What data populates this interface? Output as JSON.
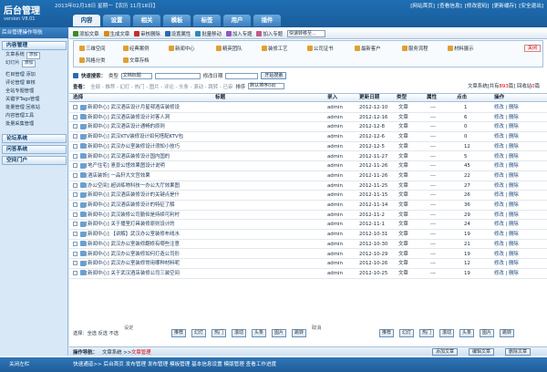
{
  "header": {
    "logo_title": "后台管理",
    "logo_version": "version V8.01",
    "date_line": "2013年02月18日 星期一【农历 11月18日】",
    "date_link": "农历 11月18日",
    "links": [
      "[网站首页]",
      "[查看信息]",
      "[修改密码]",
      "[更新缓存]",
      "[安全退出]"
    ],
    "tabs": [
      "内容",
      "设置",
      "相关",
      "模板",
      "标签",
      "用户",
      "插件"
    ]
  },
  "sidebar": {
    "title": "后台管理操作导航",
    "sections": [
      {
        "head": "内容管理",
        "items": [
          {
            "label": "文章系统",
            "btn": "添加"
          },
          {
            "label": "幻灯片",
            "btn": "添加"
          }
        ]
      },
      {
        "head": "",
        "items": [
          {
            "label": "栏目管理 添加"
          },
          {
            "label": "评论管理 审核"
          },
          {
            "label": "全站专题管理"
          },
          {
            "label": "关键字Tags管理"
          },
          {
            "label": "批量管理 回收站"
          },
          {
            "label": "内容管理工具"
          },
          {
            "label": "批量采集管理"
          }
        ]
      }
    ],
    "groups": [
      "论坛系统",
      "问答系统",
      "空间门户"
    ]
  },
  "toolbar": {
    "items": [
      {
        "label": "添加文章",
        "color": "#3d8a2a"
      },
      {
        "label": "生成文章",
        "color": "#d88a1a"
      },
      {
        "label": "审核删除",
        "color": "#c03030"
      },
      {
        "label": "设置属性",
        "color": "#2a6ab0"
      },
      {
        "label": "批量移动",
        "color": "#2a8ab0"
      },
      {
        "label": "加入专题",
        "color": "#8a5ac0"
      },
      {
        "label": "加入专题",
        "color": "#c05a8a"
      }
    ],
    "search_select": "快速转移至..."
  },
  "categories": [
    "三维空间",
    "经典案例",
    "新闻中心",
    "精英团队",
    "装修工艺",
    "公司证书",
    "最新客户",
    "服务流程",
    "材料展示",
    "风格分类",
    "文章存档"
  ],
  "close_label": "关闭",
  "quick_search": {
    "label": "快速搜索：",
    "type_label": "类型",
    "type_value": "文档标题",
    "date_label": "修改日期",
    "button": "开始搜索"
  },
  "filter": {
    "prefix": "查看：",
    "options": "全部 - 推荐 - 幻灯 - 热门 - 图片 - 评论 - 头条 - 滚动 - 跳转 - 已审",
    "sort_label": "排序",
    "sort_value": "默认排序(id)",
    "stats_prefix": "文章系统[共有",
    "stats_total": "893",
    "stats_mid": "篇]  回收站",
    "stats_recycle": "0",
    "stats_suffix": "篇"
  },
  "table": {
    "headers": [
      "选择",
      "标题",
      "录入",
      "更新日期",
      "类型",
      "属性",
      "点击",
      "操作"
    ],
    "rows": [
      {
        "title": "[新闻中心] 武汉酒店设计月星鄂酒店装修设",
        "author": "admin",
        "date": "2012-12-10",
        "type": "文章",
        "attr": "---",
        "hits": "1",
        "ops": "修改 | 删除"
      },
      {
        "title": "[新闻中心] 武汉酒店装修设计对客人洞",
        "author": "admin",
        "date": "2012-12-16",
        "type": "文章",
        "attr": "---",
        "hits": "6",
        "ops": "修改 | 删除"
      },
      {
        "title": "[新闻中心] 武汉酒店设计通畅的原则",
        "author": "admin",
        "date": "2012-12-8",
        "type": "文章",
        "attr": "---",
        "hits": "0",
        "ops": "修改 | 删除"
      },
      {
        "title": "[新闻中心] 武汉KTV装修设计如何搭配KTV包",
        "author": "admin",
        "date": "2012-12-6",
        "type": "文章",
        "attr": "---",
        "hits": "0",
        "ops": "修改 | 删除"
      },
      {
        "title": "[新闻中心] 武汉办公室装修设计须知小技巧",
        "author": "admin",
        "date": "2012-12-5",
        "type": "文章",
        "attr": "---",
        "hits": "12",
        "ops": "修改 | 删除"
      },
      {
        "title": "[新闻中心] 武汉酒店装修设计国内国的",
        "author": "admin",
        "date": "2012-11-27",
        "type": "文章",
        "attr": "---",
        "hits": "5",
        "ops": "修改 | 删除"
      },
      {
        "title": "[地产住宅] 憙景公馆效果图设计说明",
        "author": "admin",
        "date": "2012-11-26",
        "type": "文章",
        "attr": "---",
        "hits": "45",
        "ops": "修改 | 删除"
      },
      {
        "title": "[酒店装饰] 一品轩大文宫效果",
        "author": "admin",
        "date": "2012-11-26",
        "type": "文章",
        "attr": "---",
        "hits": "22",
        "ops": "修改 | 删除"
      },
      {
        "title": "[办公空间] 超训练物科技一办公大厅效果图",
        "author": "admin",
        "date": "2012-11-25",
        "type": "文章",
        "attr": "---",
        "hits": "27",
        "ops": "修改 | 删除"
      },
      {
        "title": "[新闻中心] 武汉酒店装修设计的关键点是什",
        "author": "admin",
        "date": "2012-11-15",
        "type": "文章",
        "attr": "---",
        "hits": "26",
        "ops": "修改 | 删除"
      },
      {
        "title": "[新闻中心] 武汉酒店装修设计的特征了解",
        "author": "admin",
        "date": "2012-11-14",
        "type": "文章",
        "attr": "---",
        "hits": "36",
        "ops": "修改 | 删除"
      },
      {
        "title": "[新闻中心] 武汉装修公司勤俭是持续可利村",
        "author": "admin",
        "date": "2012-11-2",
        "type": "文章",
        "attr": "---",
        "hits": "29",
        "ops": "修改 | 删除"
      },
      {
        "title": "[新闻中心] 关于播室灯具装修原则设计的",
        "author": "admin",
        "date": "2012-11-1",
        "type": "文章",
        "attr": "---",
        "hits": "24",
        "ops": "修改 | 删除"
      },
      {
        "title": "[新闻中心] 【讲解】武汉办公室装修布线水",
        "author": "admin",
        "date": "2012-10-31",
        "type": "文章",
        "attr": "---",
        "hits": "19",
        "ops": "修改 | 删除"
      },
      {
        "title": "[新闻中心] 武汉办公室装修翻修有哪些注意",
        "author": "admin",
        "date": "2012-10-30",
        "type": "文章",
        "attr": "---",
        "hits": "21",
        "ops": "修改 | 删除"
      },
      {
        "title": "[新闻中心] 武汉办公室装修如何打造公司形",
        "author": "admin",
        "date": "2012-10-29",
        "type": "文章",
        "attr": "---",
        "hits": "19",
        "ops": "修改 | 删除"
      },
      {
        "title": "[新闻中心] 武汉办公室装修常用哪种材料呢",
        "author": "admin",
        "date": "2012-10-26",
        "type": "文章",
        "attr": "---",
        "hits": "12",
        "ops": "修改 | 删除"
      },
      {
        "title": "[新闻中心] 关于武汉酒店装修公司三装空间",
        "author": "admin",
        "date": "2012-10-25",
        "type": "文章",
        "attr": "---",
        "hits": "19",
        "ops": "修改 | 删除"
      }
    ]
  },
  "footer_bar": {
    "select_label": "选择：全选  反选  不选",
    "set_label": "设定",
    "cancel_label": "取消",
    "set_buttons": [
      "推荐",
      "幻灯",
      "热门",
      "滚动",
      "头条",
      "图片",
      "跳转"
    ],
    "cancel_buttons": [
      "推荐",
      "幻灯",
      "热门",
      "滚动",
      "头条",
      "图片",
      "跳转"
    ]
  },
  "nav": {
    "prefix": "操作导航：",
    "path": "文章系统 >>",
    "current": "文章管理",
    "buttons": [
      "添加文章",
      "编辑文章",
      "删除文章"
    ]
  },
  "footer": {
    "left": "关闭左栏",
    "links": "快速通道>>  后台首页  发布管理  发布管理  模板管理  基本信息设置  模版管理  查看工作进度"
  }
}
